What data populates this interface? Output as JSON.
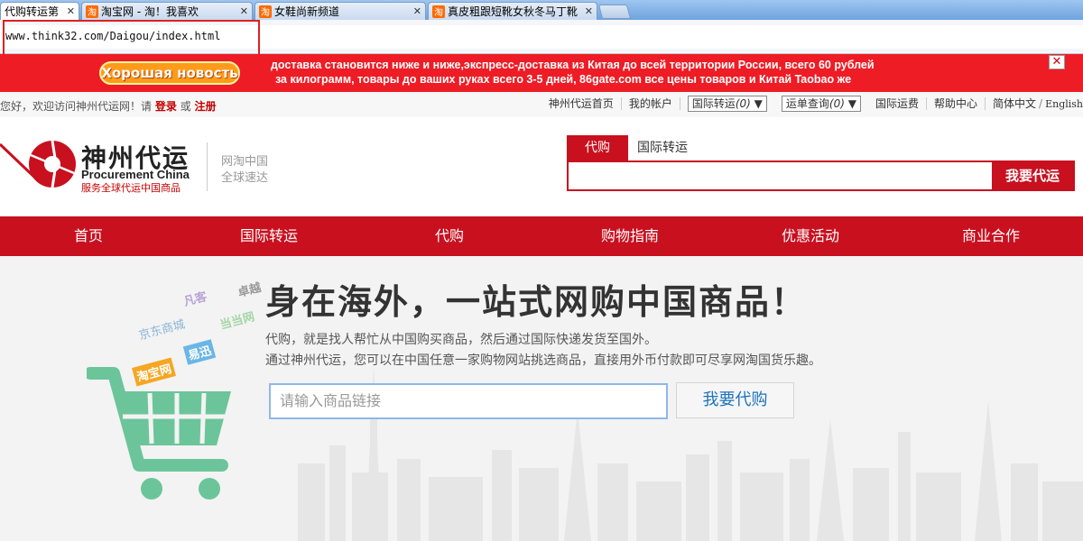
{
  "browser": {
    "tabs": [
      {
        "title": "代购转运第",
        "active": true
      },
      {
        "title": "淘宝网 - 淘！我喜欢",
        "active": false
      },
      {
        "title": "女鞋尚新频道",
        "active": false
      },
      {
        "title": "真皮粗跟短靴女秋冬马丁靴",
        "active": false
      }
    ],
    "favicon_glyph": "淘",
    "close_glyph": "✕",
    "url": "www.think32.com/Daigou/index.html",
    "highlight_color": "#e02020"
  },
  "banner": {
    "badge": "Хорошая новость",
    "line1": "доставка становится ниже и ниже,экспресс-доставка из Китая до всей территории России, всего 60 рублей",
    "line2": "за килограмм, товары до ваших руках всего 3-5 дней, 86gate.com все цены товаров и Китай Taobao же",
    "close": "✕",
    "color": "#ee1c25"
  },
  "utility": {
    "welcome_prefix": "您好，欢迎访问神州代运网！请",
    "login": "登录",
    "or": "或",
    "register": "注册",
    "home": "神州代运首页",
    "account": "我的帐户",
    "transfer_dd": "国际转运",
    "transfer_count": "(0)",
    "waybill_dd": "运单查询",
    "waybill_count": "(0)",
    "shipping_fee": "国际运费",
    "help": "帮助中心",
    "lang_cn": "简体中文",
    "lang_sep": "/",
    "lang_en": "English",
    "dd_arrow": "▼"
  },
  "header": {
    "logo_cn": "神州代运",
    "logo_en": "Procurement China",
    "logo_sub": "服务全球代运中国商品",
    "slogan1": "网淘中国",
    "slogan2": "全球速达",
    "search_tabs": [
      "代购",
      "国际转运"
    ],
    "search_button": "我要代运",
    "brand_red": "#c8101f"
  },
  "nav": {
    "items": [
      "首页",
      "国际转运",
      "代购",
      "购物指南",
      "优惠活动",
      "商业合作"
    ]
  },
  "hero": {
    "title": "身在海外，一站式网购中国商品！",
    "p1": "代购，就是找人帮忙从中国购买商品，然后通过国际快递发货至国外。",
    "p2": "通过神州代运，您可以在中国任意一家购物网站挑选商品，直接用外币付款即可尽享网淘国货乐趣。",
    "input_placeholder": "请输入商品链接",
    "button": "我要代购",
    "tags": [
      "凡客",
      "卓越",
      "京东商城",
      "当当网",
      "淘宝网",
      "易迅"
    ],
    "cart_color": "#6cc59a"
  }
}
